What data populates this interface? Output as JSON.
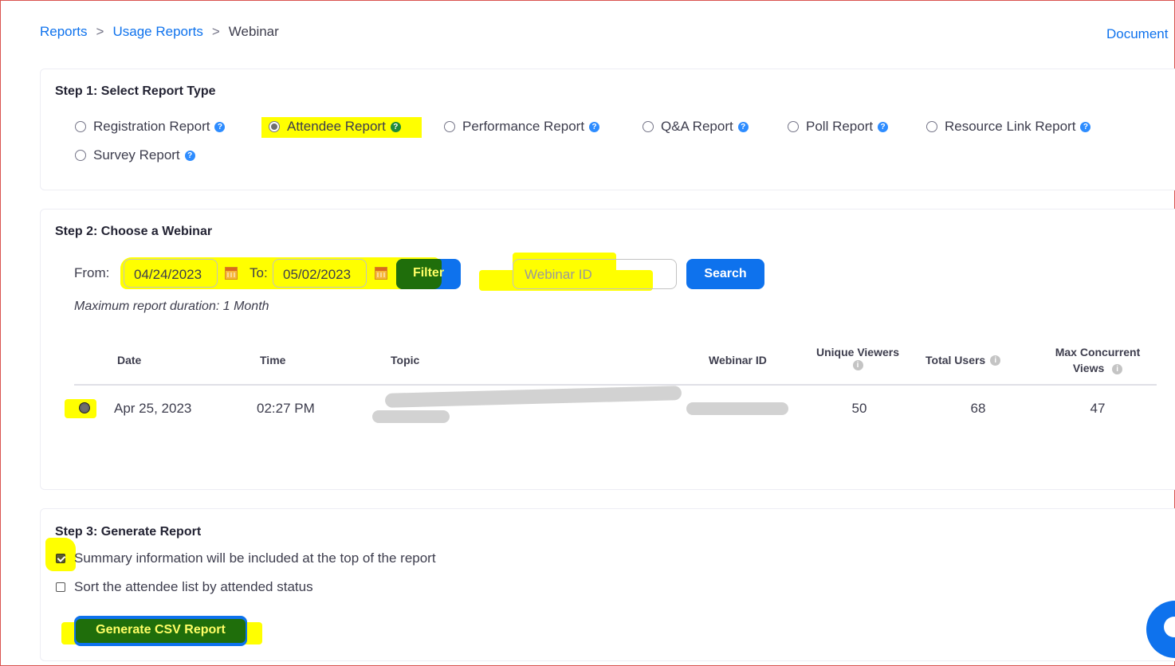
{
  "breadcrumb": {
    "reports": "Reports",
    "usage_reports": "Usage Reports",
    "current": "Webinar",
    "separator": ">"
  },
  "header": {
    "documentation_link": "Document"
  },
  "step1": {
    "title": "Step 1: Select Report Type",
    "options": [
      {
        "label": "Registration Report",
        "selected": false
      },
      {
        "label": "Attendee Report",
        "selected": true
      },
      {
        "label": "Performance Report",
        "selected": false
      },
      {
        "label": "Q&A Report",
        "selected": false
      },
      {
        "label": "Poll Report",
        "selected": false
      },
      {
        "label": "Resource Link Report",
        "selected": false
      },
      {
        "label": "Survey Report",
        "selected": false
      }
    ]
  },
  "step2": {
    "title": "Step 2: Choose a Webinar",
    "from_label": "From:",
    "from_value": "04/24/2023",
    "to_label": "To:",
    "to_value": "05/02/2023",
    "filter_label": "Filter",
    "webinar_id_placeholder": "Webinar ID",
    "search_label": "Search",
    "max_duration_note": "Maximum report duration: 1 Month",
    "table": {
      "headers": {
        "date": "Date",
        "time": "Time",
        "topic": "Topic",
        "webinar_id": "Webinar ID",
        "unique_viewers": "Unique Viewers",
        "total_users": "Total Users",
        "max_concurrent_views": "Max Concurrent Views"
      },
      "rows": [
        {
          "selected": true,
          "date": "Apr 25, 2023",
          "time": "02:27 PM",
          "topic": "",
          "webinar_id": "",
          "unique_viewers": "50",
          "total_users": "68",
          "max_concurrent_views": "47"
        }
      ]
    }
  },
  "step3": {
    "title": "Step 3: Generate Report",
    "option_summary": {
      "label": "Summary information will be included at the top of the report",
      "checked": true
    },
    "option_sort": {
      "label": "Sort the attendee list by attended status",
      "checked": false
    },
    "generate_label": "Generate CSV Report"
  },
  "colors": {
    "accent": "#0e72ed",
    "highlight": "#ffff00",
    "highlight_dark": "#1f6e0b",
    "help_icon": "#2d8cff"
  },
  "icons": {
    "help": "question-circle-icon",
    "info": "info-circle-icon",
    "calendar": "calendar-icon",
    "chat": "chat-bubble-icon"
  }
}
